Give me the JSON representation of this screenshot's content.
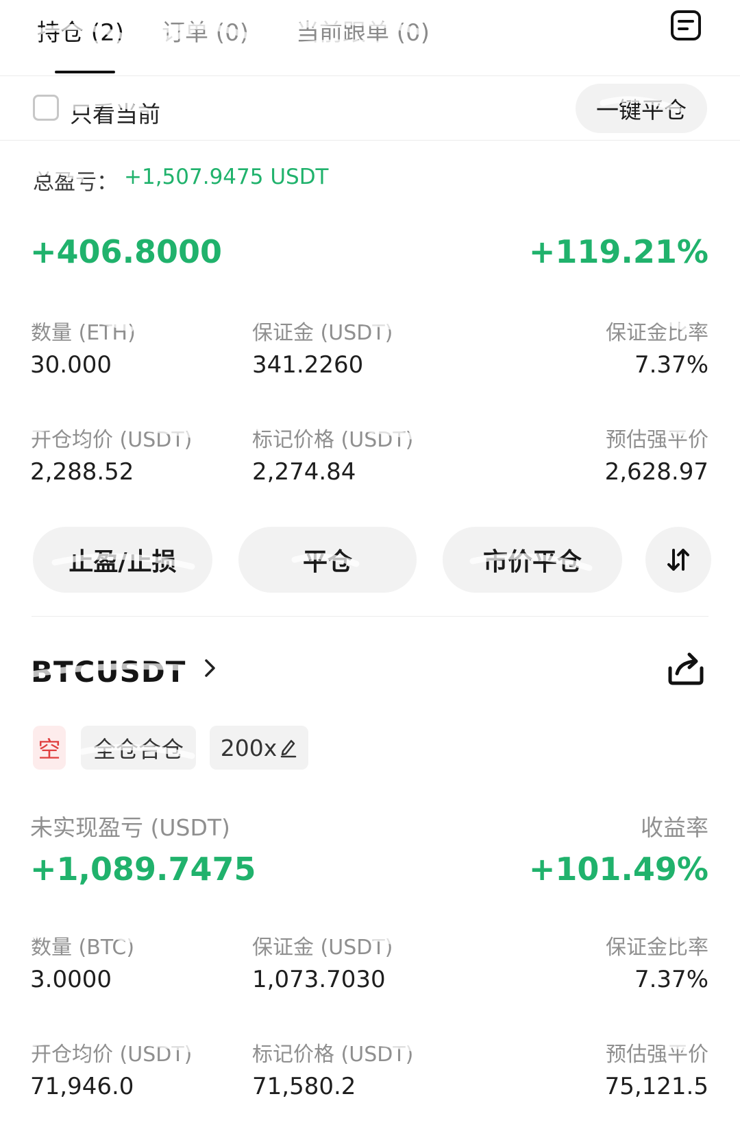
{
  "tabs": [
    {
      "label": "持仓 (2)"
    },
    {
      "label": "订单 (0)"
    },
    {
      "label": "当前跟单 (0)"
    }
  ],
  "filter": {
    "only_current_label": "只看当前",
    "close_all_label": "一键平仓"
  },
  "summary": {
    "total_pnl_label": "总盈亏：",
    "total_pnl_value": "+1,507.9475 USDT"
  },
  "positions": [
    {
      "unrealized_pnl": "+406.8000",
      "roi": "+119.21%",
      "fields": [
        {
          "label": "数量 (ETH)",
          "value": "30.000"
        },
        {
          "label": "保证金 (USDT)",
          "value": "341.2260"
        },
        {
          "label": "保证金比率",
          "value": "7.37%"
        },
        {
          "label": "开仓均价 (USDT)",
          "value": "2,288.52"
        },
        {
          "label": "标记价格 (USDT)",
          "value": "2,274.84"
        },
        {
          "label": "预估强平价",
          "value": "2,628.97"
        }
      ],
      "actions": {
        "tp_sl": "止盈/止损",
        "close": "平仓",
        "market_close": "市价平仓"
      }
    },
    {
      "symbol": "BTCUSDT",
      "side": "空",
      "margin_mode": "全仓合仓",
      "leverage": "200x",
      "pnl_label": "未实现盈亏 (USDT)",
      "roi_label": "收益率",
      "unrealized_pnl": "+1,089.7475",
      "roi": "+101.49%",
      "fields": [
        {
          "label": "数量 (BTC)",
          "value": "3.0000"
        },
        {
          "label": "保证金 (USDT)",
          "value": "1,073.7030"
        },
        {
          "label": "保证金比率",
          "value": "7.37%"
        },
        {
          "label": "开仓均价 (USDT)",
          "value": "71,946.0"
        },
        {
          "label": "标记价格 (USDT)",
          "value": "71,580.2"
        },
        {
          "label": "预估强平价",
          "value": "75,121.5"
        }
      ]
    }
  ],
  "colors": {
    "green": "#20b26c",
    "red": "#e04040",
    "pill_bg": "#f2f2f2"
  },
  "icons": [
    "orders-list-icon",
    "checkbox-icon",
    "swap-icon",
    "chevron-right-icon",
    "share-icon",
    "edit-pencil-icon"
  ]
}
